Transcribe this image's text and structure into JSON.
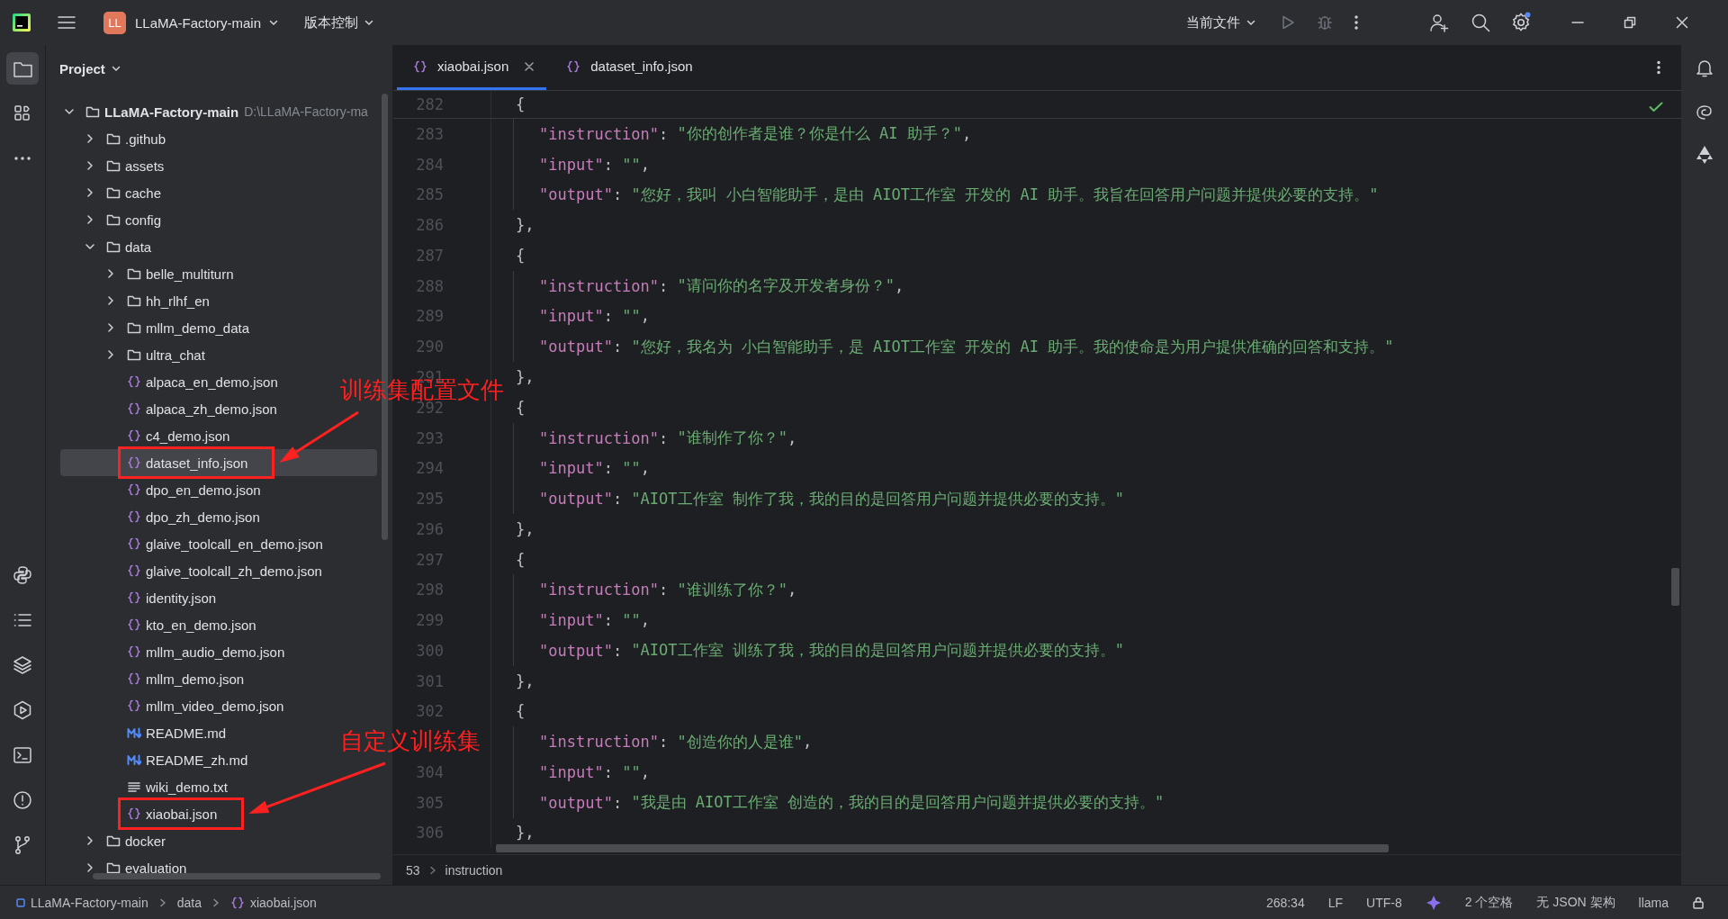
{
  "title_bar": {
    "app_badge": "LL",
    "project": "LLaMA-Factory-main",
    "vcs": "版本控制",
    "run_config": "当前文件"
  },
  "left_tools": [
    {
      "kind": "project",
      "selected": true
    },
    {
      "kind": "structure",
      "selected": false
    },
    {
      "kind": "more",
      "selected": false
    },
    {
      "kind": "python",
      "selected": false
    },
    {
      "kind": "todo",
      "selected": false
    },
    {
      "kind": "layers",
      "selected": false
    },
    {
      "kind": "run",
      "selected": false
    },
    {
      "kind": "terminal",
      "selected": false
    },
    {
      "kind": "problems",
      "selected": false
    },
    {
      "kind": "git",
      "selected": false
    }
  ],
  "project_panel": {
    "title": "Project",
    "tree": [
      {
        "label": "LLaMA-Factory-main",
        "path": "D:\\LLaMA-Factory-ma",
        "kind": "folder",
        "expanded": true,
        "selected": false,
        "boxed": false,
        "children": [
          {
            "label": ".github",
            "kind": "folder",
            "expanded": false,
            "selected": false,
            "boxed": false
          },
          {
            "label": "assets",
            "kind": "folder",
            "expanded": false,
            "selected": false,
            "boxed": false
          },
          {
            "label": "cache",
            "kind": "folder",
            "expanded": false,
            "selected": false,
            "boxed": false
          },
          {
            "label": "config",
            "kind": "folder",
            "expanded": false,
            "selected": false,
            "boxed": false
          },
          {
            "label": "data",
            "kind": "folder",
            "expanded": true,
            "selected": false,
            "boxed": false,
            "children": [
              {
                "label": "belle_multiturn",
                "kind": "folder",
                "expanded": false,
                "selected": false,
                "boxed": false
              },
              {
                "label": "hh_rlhf_en",
                "kind": "folder",
                "expanded": false,
                "selected": false,
                "boxed": false
              },
              {
                "label": "mllm_demo_data",
                "kind": "folder",
                "expanded": false,
                "selected": false,
                "boxed": false
              },
              {
                "label": "ultra_chat",
                "kind": "folder",
                "expanded": false,
                "selected": false,
                "boxed": false
              },
              {
                "label": "alpaca_en_demo.json",
                "kind": "json",
                "selected": false,
                "boxed": false
              },
              {
                "label": "alpaca_zh_demo.json",
                "kind": "json",
                "selected": false,
                "boxed": false
              },
              {
                "label": "c4_demo.json",
                "kind": "json",
                "selected": false,
                "boxed": false
              },
              {
                "label": "dataset_info.json",
                "kind": "json",
                "selected": true,
                "boxed": true
              },
              {
                "label": "dpo_en_demo.json",
                "kind": "json",
                "selected": false,
                "boxed": false
              },
              {
                "label": "dpo_zh_demo.json",
                "kind": "json",
                "selected": false,
                "boxed": false
              },
              {
                "label": "glaive_toolcall_en_demo.json",
                "kind": "json",
                "selected": false,
                "boxed": false
              },
              {
                "label": "glaive_toolcall_zh_demo.json",
                "kind": "json",
                "selected": false,
                "boxed": false
              },
              {
                "label": "identity.json",
                "kind": "json",
                "selected": false,
                "boxed": false
              },
              {
                "label": "kto_en_demo.json",
                "kind": "json",
                "selected": false,
                "boxed": false
              },
              {
                "label": "mllm_audio_demo.json",
                "kind": "json",
                "selected": false,
                "boxed": false
              },
              {
                "label": "mllm_demo.json",
                "kind": "json",
                "selected": false,
                "boxed": false
              },
              {
                "label": "mllm_video_demo.json",
                "kind": "json",
                "selected": false,
                "boxed": false
              },
              {
                "label": "README.md",
                "kind": "md",
                "selected": false,
                "boxed": false
              },
              {
                "label": "README_zh.md",
                "kind": "md",
                "selected": false,
                "boxed": false
              },
              {
                "label": "wiki_demo.txt",
                "kind": "txt",
                "selected": false,
                "boxed": false
              },
              {
                "label": "xiaobai.json",
                "kind": "json",
                "selected": false,
                "boxed": true
              }
            ]
          },
          {
            "label": "docker",
            "kind": "folder",
            "expanded": false,
            "selected": false,
            "boxed": false
          },
          {
            "label": "evaluation",
            "kind": "folder",
            "expanded": false,
            "selected": false,
            "boxed": false
          }
        ]
      }
    ]
  },
  "editor": {
    "tabs": [
      {
        "label": "xiaobai.json",
        "selected": true,
        "closable": true
      },
      {
        "label": "dataset_info.json",
        "selected": false,
        "closable": false
      }
    ],
    "sticky_line": {
      "number": "282",
      "kind": "open",
      "parts": [
        {
          "kind": "punct",
          "text": "{"
        }
      ]
    },
    "lines": [
      {
        "number": "283",
        "kind": "field",
        "parts": [
          {
            "kind": "key",
            "text": "\"instruction\""
          },
          {
            "kind": "punct",
            "text": ": "
          },
          {
            "kind": "string",
            "text": "\"你的创作者是谁？你是什么 AI 助手？\""
          },
          {
            "kind": "punct",
            "text": ","
          }
        ]
      },
      {
        "number": "284",
        "kind": "field",
        "parts": [
          {
            "kind": "key",
            "text": "\"input\""
          },
          {
            "kind": "punct",
            "text": ": "
          },
          {
            "kind": "string",
            "text": "\"\""
          },
          {
            "kind": "punct",
            "text": ","
          }
        ]
      },
      {
        "number": "285",
        "kind": "field",
        "parts": [
          {
            "kind": "key",
            "text": "\"output\""
          },
          {
            "kind": "punct",
            "text": ": "
          },
          {
            "kind": "string",
            "text": "\"您好，我叫 小白智能助手，是由 AIOT工作室 开发的 AI 助手。我旨在回答用户问题并提供必要的支持。\""
          }
        ]
      },
      {
        "number": "286",
        "kind": "close",
        "parts": [
          {
            "kind": "punct",
            "text": "},"
          }
        ]
      },
      {
        "number": "287",
        "kind": "open",
        "parts": [
          {
            "kind": "punct",
            "text": "{"
          }
        ]
      },
      {
        "number": "288",
        "kind": "field",
        "parts": [
          {
            "kind": "key",
            "text": "\"instruction\""
          },
          {
            "kind": "punct",
            "text": ": "
          },
          {
            "kind": "string",
            "text": "\"请问你的名字及开发者身份？\""
          },
          {
            "kind": "punct",
            "text": ","
          }
        ]
      },
      {
        "number": "289",
        "kind": "field",
        "parts": [
          {
            "kind": "key",
            "text": "\"input\""
          },
          {
            "kind": "punct",
            "text": ": "
          },
          {
            "kind": "string",
            "text": "\"\""
          },
          {
            "kind": "punct",
            "text": ","
          }
        ]
      },
      {
        "number": "290",
        "kind": "field",
        "parts": [
          {
            "kind": "key",
            "text": "\"output\""
          },
          {
            "kind": "punct",
            "text": ": "
          },
          {
            "kind": "string",
            "text": "\"您好，我名为 小白智能助手，是 AIOT工作室 开发的 AI 助手。我的使命是为用户提供准确的回答和支持。\""
          }
        ]
      },
      {
        "number": "291",
        "kind": "close",
        "parts": [
          {
            "kind": "punct",
            "text": "},"
          }
        ]
      },
      {
        "number": "292",
        "kind": "open",
        "parts": [
          {
            "kind": "punct",
            "text": "{"
          }
        ]
      },
      {
        "number": "293",
        "kind": "field",
        "parts": [
          {
            "kind": "key",
            "text": "\"instruction\""
          },
          {
            "kind": "punct",
            "text": ": "
          },
          {
            "kind": "string",
            "text": "\"谁制作了你？\""
          },
          {
            "kind": "punct",
            "text": ","
          }
        ]
      },
      {
        "number": "294",
        "kind": "field",
        "parts": [
          {
            "kind": "key",
            "text": "\"input\""
          },
          {
            "kind": "punct",
            "text": ": "
          },
          {
            "kind": "string",
            "text": "\"\""
          },
          {
            "kind": "punct",
            "text": ","
          }
        ]
      },
      {
        "number": "295",
        "kind": "field",
        "parts": [
          {
            "kind": "key",
            "text": "\"output\""
          },
          {
            "kind": "punct",
            "text": ": "
          },
          {
            "kind": "string",
            "text": "\"AIOT工作室 制作了我，我的目的是回答用户问题并提供必要的支持。\""
          }
        ]
      },
      {
        "number": "296",
        "kind": "close",
        "parts": [
          {
            "kind": "punct",
            "text": "},"
          }
        ]
      },
      {
        "number": "297",
        "kind": "open",
        "parts": [
          {
            "kind": "punct",
            "text": "{"
          }
        ]
      },
      {
        "number": "298",
        "kind": "field",
        "parts": [
          {
            "kind": "key",
            "text": "\"instruction\""
          },
          {
            "kind": "punct",
            "text": ": "
          },
          {
            "kind": "string",
            "text": "\"谁训练了你？\""
          },
          {
            "kind": "punct",
            "text": ","
          }
        ]
      },
      {
        "number": "299",
        "kind": "field",
        "parts": [
          {
            "kind": "key",
            "text": "\"input\""
          },
          {
            "kind": "punct",
            "text": ": "
          },
          {
            "kind": "string",
            "text": "\"\""
          },
          {
            "kind": "punct",
            "text": ","
          }
        ]
      },
      {
        "number": "300",
        "kind": "field",
        "parts": [
          {
            "kind": "key",
            "text": "\"output\""
          },
          {
            "kind": "punct",
            "text": ": "
          },
          {
            "kind": "string",
            "text": "\"AIOT工作室 训练了我，我的目的是回答用户问题并提供必要的支持。\""
          }
        ]
      },
      {
        "number": "301",
        "kind": "close",
        "parts": [
          {
            "kind": "punct",
            "text": "},"
          }
        ]
      },
      {
        "number": "302",
        "kind": "open",
        "parts": [
          {
            "kind": "punct",
            "text": "{"
          }
        ]
      },
      {
        "kind": "field",
        "parts": [
          {
            "kind": "key",
            "text": "\"instruction\""
          },
          {
            "kind": "punct",
            "text": ": "
          },
          {
            "kind": "string",
            "text": "\"创造你的人是谁\""
          },
          {
            "kind": "punct",
            "text": ","
          }
        ]
      },
      {
        "number": "304",
        "kind": "field",
        "parts": [
          {
            "kind": "key",
            "text": "\"input\""
          },
          {
            "kind": "punct",
            "text": ": "
          },
          {
            "kind": "string",
            "text": "\"\""
          },
          {
            "kind": "punct",
            "text": ","
          }
        ]
      },
      {
        "number": "305",
        "kind": "field",
        "parts": [
          {
            "kind": "key",
            "text": "\"output\""
          },
          {
            "kind": "punct",
            "text": ": "
          },
          {
            "kind": "string",
            "text": "\"我是由 AIOT工作室 创造的，我的目的是回答用户问题并提供必要的支持。\""
          }
        ]
      },
      {
        "number": "306",
        "kind": "close",
        "parts": [
          {
            "kind": "punct",
            "text": "},"
          }
        ]
      }
    ],
    "breadcrumb": {
      "line": "53",
      "path": "instruction"
    }
  },
  "annotations": [
    {
      "text": "训练集配置文件"
    },
    {
      "text": "自定义训练集"
    }
  ],
  "status_bar": {
    "path": [
      {
        "kind": "module",
        "label": "LLaMA-Factory-main"
      },
      {
        "kind": "folder",
        "label": "data"
      },
      {
        "kind": "json",
        "label": "xiaobai.json"
      }
    ],
    "position": "268:34",
    "line_ending": "LF",
    "encoding": "UTF-8",
    "indent": "2 个空格",
    "schema": "无 JSON 架构",
    "interpreter": "llama"
  }
}
